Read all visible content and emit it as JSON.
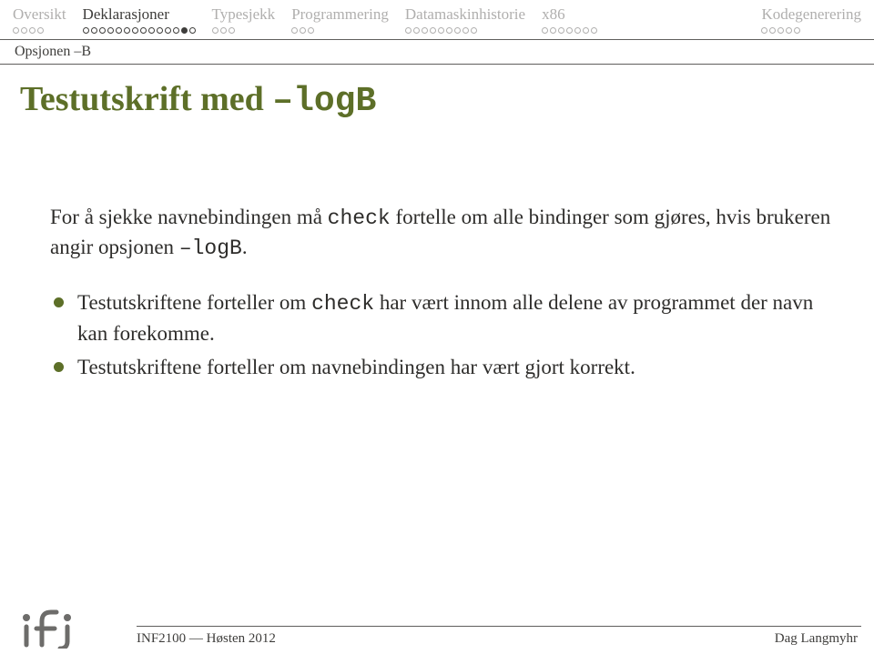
{
  "nav": {
    "items": [
      {
        "label": "Oversikt",
        "active": false,
        "dots": 4,
        "filled": -1
      },
      {
        "label": "Deklarasjoner",
        "active": true,
        "dots": 14,
        "filled": 12
      },
      {
        "label": "Typesjekk",
        "active": false,
        "dots": 3,
        "filled": -1
      },
      {
        "label": "Programmering",
        "active": false,
        "dots": 3,
        "filled": -1
      },
      {
        "label": "Datamaskinhistorie",
        "active": false,
        "dots": 9,
        "filled": -1
      },
      {
        "label": "x86",
        "active": false,
        "dots": 7,
        "filled": -1
      },
      {
        "label": "Kodegenerering",
        "active": false,
        "dots": 5,
        "filled": -1
      }
    ]
  },
  "section_label": "Opsjonen –B",
  "title": {
    "prefix": "Testutskrift med ",
    "flag": "–logB"
  },
  "body": {
    "para_part1": "For å sjekke navnebindingen må ",
    "para_code1": "check",
    "para_part2": " fortelle om alle bindinger som gjøres, hvis brukeren angir opsjonen ",
    "para_code2": "–logB",
    "para_part3": ".",
    "bullets": [
      {
        "t1": "Testutskriftene forteller om ",
        "c1": "check",
        "t2": " har vært innom alle delene av programmet der navn kan forekomme."
      },
      {
        "t1": "Testutskriftene forteller om navnebindingen har vært gjort korrekt.",
        "c1": "",
        "t2": ""
      }
    ]
  },
  "footer": {
    "left": "INF2100 — Høsten 2012",
    "right": "Dag Langmyhr"
  }
}
